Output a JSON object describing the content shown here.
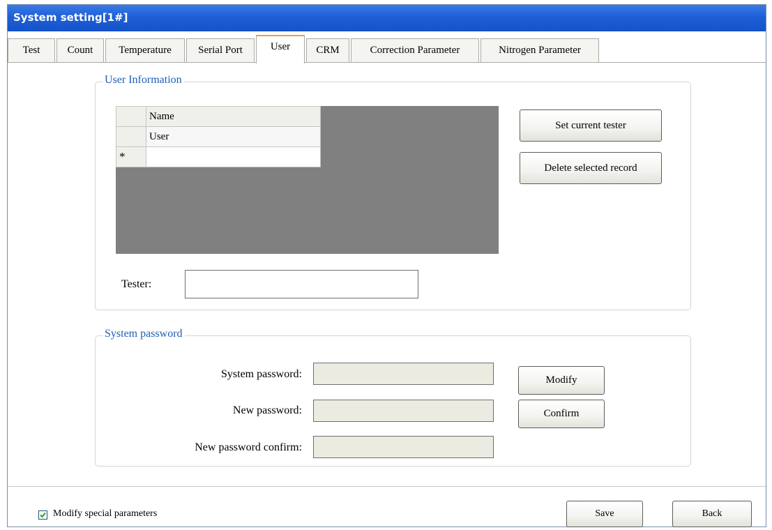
{
  "window": {
    "title": "System setting[1#]"
  },
  "tabs": [
    {
      "label": "Test"
    },
    {
      "label": "Count"
    },
    {
      "label": "Temperature"
    },
    {
      "label": "Serial Port"
    },
    {
      "label": "User",
      "active": true
    },
    {
      "label": "CRM"
    },
    {
      "label": "Correction Parameter"
    },
    {
      "label": "Nitrogen Parameter"
    }
  ],
  "user_info": {
    "group_title": "User Information",
    "grid": {
      "column_header": "Name",
      "rows": [
        "User"
      ],
      "new_row_marker": "*"
    },
    "set_current_tester_label": "Set current tester",
    "delete_selected_label": "Delete selected record",
    "tester_label": "Tester:",
    "tester_value": ""
  },
  "system_password": {
    "group_title": "System password",
    "system_password_label": "System password:",
    "new_password_label": "New password:",
    "new_password_confirm_label": "New password confirm:",
    "modify_label": "Modify",
    "confirm_label": "Confirm"
  },
  "footer": {
    "modify_special_label": "Modify special parameters",
    "modify_special_checked": true,
    "save_label": "Save",
    "back_label": "Back"
  },
  "colors": {
    "title_bar": "#1f5fd6",
    "group_title": "#1e5cb3",
    "grid_background": "#808080",
    "active_tab_accent": "#f0a030"
  }
}
